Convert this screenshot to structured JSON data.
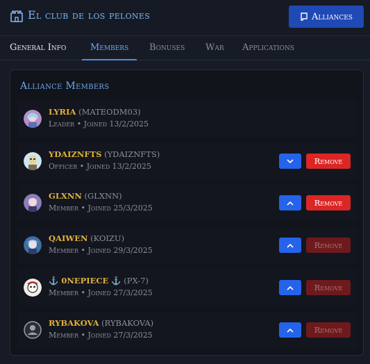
{
  "header": {
    "club_name": "El club de los pelones",
    "alliances_label": "Alliances",
    "castle_icon": "castle-icon",
    "alliances_icon": "scroll-icon"
  },
  "tabs": [
    {
      "label": "General Info",
      "active": false
    },
    {
      "label": "Members",
      "active": true
    },
    {
      "label": "Bonuses",
      "active": false
    },
    {
      "label": "War",
      "active": false
    },
    {
      "label": "Applications",
      "active": false
    }
  ],
  "panel": {
    "title": "Alliance Members"
  },
  "members": [
    {
      "name": "LYRIA",
      "handle": "(MATEODM03)",
      "meta": "Leader • Joined 13/2/2025",
      "rank_action": "none",
      "remove_label": "",
      "avatar": "anime-avatar"
    },
    {
      "name": "YDAIZNFTS",
      "handle": "(YDAIZNFTS)",
      "meta": "Officer • Joined 13/2/2025",
      "rank_action": "demote",
      "remove_label": "Remove",
      "remove_enabled": true,
      "avatar": "robot-avatar"
    },
    {
      "name": "GLXNN",
      "handle": "(GLXNN)",
      "meta": "Member • Joined 25/3/2025",
      "rank_action": "promote",
      "remove_label": "Remove",
      "remove_enabled": true,
      "avatar": "anime-avatar"
    },
    {
      "name": "QAIWEN",
      "handle": "(KOIZU)",
      "meta": "Member • Joined 29/3/2025",
      "rank_action": "promote",
      "remove_label": "Remove",
      "remove_enabled": false,
      "avatar": "anime-avatar"
    },
    {
      "name": "⚓ 0NEPIECE ⚓",
      "handle": "(PX-7)",
      "meta": "Member • Joined 27/3/2025",
      "rank_action": "promote",
      "remove_label": "Remove",
      "remove_enabled": false,
      "avatar": "pirate-avatar"
    },
    {
      "name": "RYBAKOVA",
      "handle": "(RYBAKOVA)",
      "meta": "Member • Joined 27/3/2025",
      "rank_action": "promote",
      "remove_label": "Remove",
      "remove_enabled": false,
      "avatar": "default-user-avatar"
    }
  ],
  "colors": {
    "accent": "#6ea9ec",
    "name_gold": "#e2b13a",
    "button_blue": "#2563eb",
    "remove_red": "#dc2626",
    "remove_disabled": "#6e1a1d"
  }
}
